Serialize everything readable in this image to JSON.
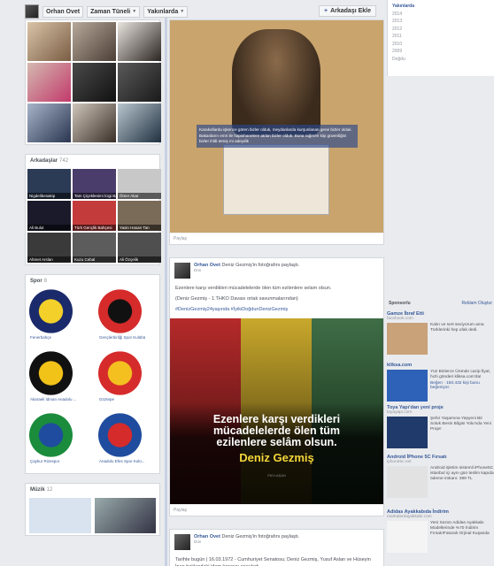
{
  "header": {
    "name": "Orhan Ovet",
    "timeline_label": "Zaman Tüneli",
    "recent_label": "Yakınlarda",
    "add_friend_label": "Arkadaşı Ekle"
  },
  "friends": {
    "title": "Arkadaşlar",
    "count": "742",
    "items": [
      {
        "name": "Nigdelibesakip",
        "color": "#2b3a55"
      },
      {
        "name": "Tam Çiçeklenimi İcigi Başlamakta",
        "color": "#4a3d6b"
      },
      {
        "name": "Ömer Akar",
        "color": "#c8c8c8"
      },
      {
        "name": "Ali Bulut",
        "color": "#1a1a2a"
      },
      {
        "name": "Türk Gençlik Bahçesi",
        "color": "#c43b3b"
      },
      {
        "name": "Yasin Hasan Tan",
        "color": "#7a6a58"
      },
      {
        "name": "Ahmet Arslan",
        "color": "#3a3a3a"
      },
      {
        "name": "Kuzu Cebal",
        "color": "#5c5c5c"
      },
      {
        "name": "Ali Özçelik",
        "color": "#4f4f4f"
      }
    ]
  },
  "sport": {
    "title": "Spor",
    "count": "8",
    "items": [
      {
        "name": "Fenerbahçe",
        "color": "#1b2a6b",
        "accent": "#f3d12a"
      },
      {
        "name": "Gençlerbirliği Spor Kulübü",
        "color": "#d62b2b",
        "accent": "#111111"
      },
      {
        "name": "Akaraeli İdman Anadolu ...",
        "color": "#111111",
        "accent": "#f1c218"
      },
      {
        "name": "Göztepe",
        "color": "#d62b2b",
        "accent": "#f3c020"
      },
      {
        "name": "Çaykur Rizespor",
        "color": "#1a8c3c",
        "accent": "#1f4c9e"
      },
      {
        "name": "Anadolu Efes Spor Kulü...",
        "color": "#1f4c9e",
        "accent": "#d62b2b"
      }
    ]
  },
  "music": {
    "title": "Müzik",
    "count": "12"
  },
  "posts": [
    {
      "footer": "Paylaş",
      "poster_text": "Karakollarda işkence gören bizler olduk, meydanlarda kurşunlanan gene bizler olduk. Bakanların emri ile hapishanelere atılan bizler olduk. Buna rağmen kişi güvenliğini bizler ihlâl etmiş mi adeydik"
    },
    {
      "author": "Orhan Ovet",
      "action": "Deniz Gezmiş'in fotoğrafını paylaştı.",
      "time": "Dün",
      "text1": "Ezenlere karşı verdikleri mücadelelerde ölen tüm ezilenlere selam olsun.",
      "text2": "(Deniz Gezmiş - 1.THKO Davası ortak savunmalarından)",
      "tags": "#DenizGezmiş24yaşında #İyikiDoğdunDenizGezmiş",
      "image_text": "Ezenlere karşı verdikleri mücadelelerde ölen tüm ezilenlere selâm olsun.",
      "image_name": "Deniz Gezmiş",
      "image_footer": "PAYLAŞAN",
      "footer": "Paylaş"
    },
    {
      "author": "Orhan Ovet",
      "action": "Deniz Gezmiş'in fotoğrafını paylaştı.",
      "time": "Dün",
      "text1": "Tarihte bugün | 16.03.1972 - Cumhuriyet Senatosu; Deniz Gezmiş, Yusuf Aslan ve Hüseyin İnan hakkındaki idam kararını onayladı."
    }
  ],
  "timeline_years": [
    "Yakınlarda",
    "2014",
    "2013",
    "2012",
    "2011",
    "2010",
    "2009",
    "Doğdu"
  ],
  "sponsored": {
    "label": "Sponsorlu",
    "create_ad": "Reklam Oluştur"
  },
  "ads": [
    {
      "title": "Gamze İbraf Etti",
      "url": "facebook.com",
      "desc": "Kalın ve sert seviyorum ama Türklerinki hep ufak dedi.",
      "like": "",
      "color": "#c9a27a"
    },
    {
      "title": "kliksa.com",
      "url": "",
      "desc": "Yüz Binlerce Üründe cazip fiyat, hızlı gönderi kliksa.com'da!",
      "like": "Beğen · 150.432 kişi bunu beğeniyor.",
      "color": "#2e62b8"
    },
    {
      "title": "Toya Yapı'dan yeni proje",
      "url": "toyayapi.com",
      "desc": "Şehir Yaşamına Yepyeni Bir Soluk Besin Bilgisi Yolu'nda Yeni Proje!",
      "like": "",
      "color": "#203b6b"
    },
    {
      "title": "Android İPhone 5C Fırsatı",
      "url": "iphone5c.net",
      "desc": "Android işletim sistemli iPhone5C istanbul içi aynı gün teslim kapıda ödeme imkanı: 399 TL",
      "like": "",
      "color": "#e2e2e2"
    },
    {
      "title": "Adidas Ayakkabıda İndirim",
      "url": "markalardayakkabi.com",
      "desc": "Yeni Sezon Adidas Ayakkabı Modellerinde %70 İndirim Fırsatı!Faturalı Orjinal Kuşanda",
      "like": "",
      "color": "#f4f4f4"
    }
  ]
}
